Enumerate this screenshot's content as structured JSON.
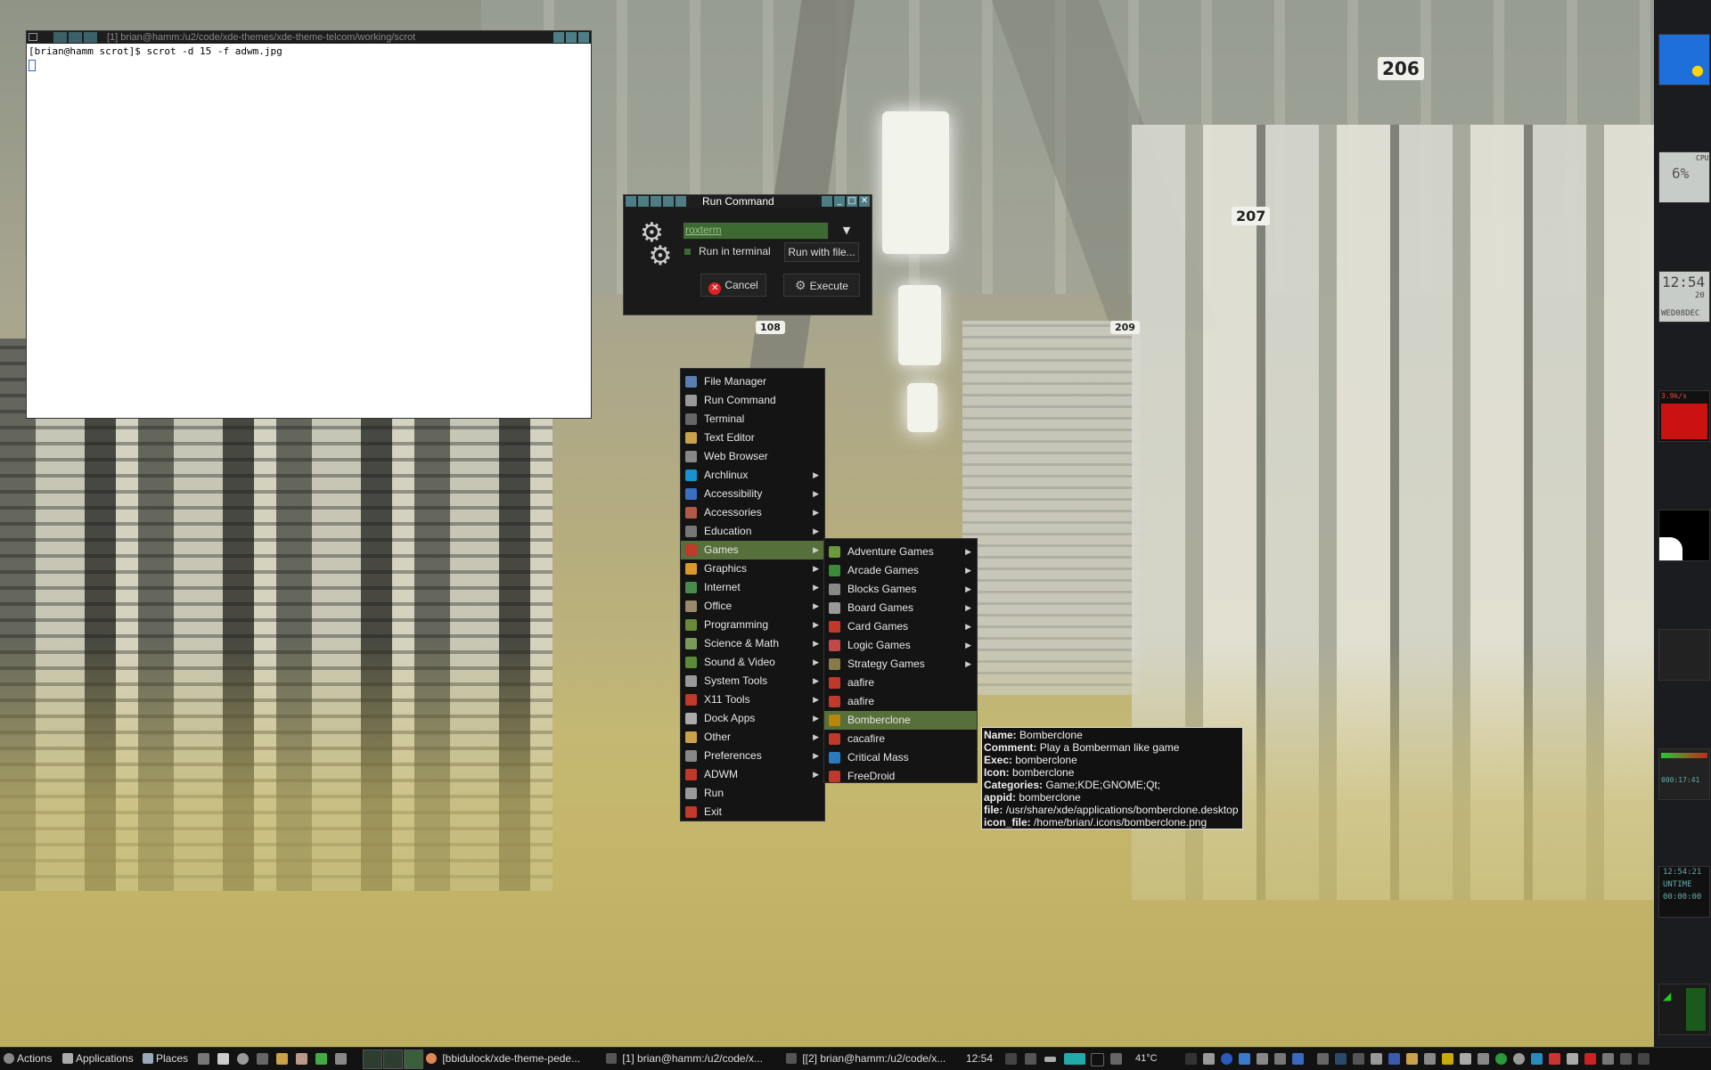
{
  "wallpaper": {
    "sign_206": "206",
    "sign_207": "207",
    "sign_108": "108",
    "sign_209": "209"
  },
  "terminal": {
    "title": "[1] brian@hamm:/u2/code/xde-themes/xde-theme-telcom/working/scrot",
    "prompt_line": "[brian@hamm scrot]$ scrot -d 15 -f adwm.jpg"
  },
  "run_command": {
    "title": "Run Command",
    "command_value": "roxterm",
    "run_in_terminal_label": "Run in terminal",
    "run_with_file_label": "Run with file...",
    "cancel_label": "Cancel",
    "execute_label": "Execute"
  },
  "main_menu": {
    "items": [
      {
        "label": "File Manager",
        "submenu": false,
        "icon": "folder-icon",
        "color": "#5a7fb0"
      },
      {
        "label": "Run Command",
        "submenu": false,
        "icon": "gears-icon",
        "color": "#9a9a9a"
      },
      {
        "label": "Terminal",
        "submenu": false,
        "icon": "terminal-icon",
        "color": "#666"
      },
      {
        "label": "Text Editor",
        "submenu": false,
        "icon": "text-editor-icon",
        "color": "#c9a24a"
      },
      {
        "label": "Web Browser",
        "submenu": false,
        "icon": "globe-icon",
        "color": "#888"
      },
      {
        "label": "Archlinux",
        "submenu": true,
        "icon": "arch-icon",
        "color": "#1793d1"
      },
      {
        "label": "Accessibility",
        "submenu": true,
        "icon": "accessibility-icon",
        "color": "#3b6fc2"
      },
      {
        "label": "Accessories",
        "submenu": true,
        "icon": "accessories-icon",
        "color": "#b05a4a"
      },
      {
        "label": "Education",
        "submenu": true,
        "icon": "education-icon",
        "color": "#777"
      },
      {
        "label": "Games",
        "submenu": true,
        "icon": "games-icon",
        "color": "#c0392b"
      },
      {
        "label": "Graphics",
        "submenu": true,
        "icon": "graphics-icon",
        "color": "#d99a2b"
      },
      {
        "label": "Internet",
        "submenu": true,
        "icon": "internet-icon",
        "color": "#4a8a4a"
      },
      {
        "label": "Office",
        "submenu": true,
        "icon": "office-icon",
        "color": "#9a8a6a"
      },
      {
        "label": "Programming",
        "submenu": true,
        "icon": "programming-icon",
        "color": "#6a8a3a"
      },
      {
        "label": "Science & Math",
        "submenu": true,
        "icon": "science-icon",
        "color": "#7a9a5a"
      },
      {
        "label": "Sound & Video",
        "submenu": true,
        "icon": "multimedia-icon",
        "color": "#5a8a3a"
      },
      {
        "label": "System Tools",
        "submenu": true,
        "icon": "system-tools-icon",
        "color": "#999"
      },
      {
        "label": "X11 Tools",
        "submenu": true,
        "icon": "x11-icon",
        "color": "#c0392b"
      },
      {
        "label": "Dock Apps",
        "submenu": true,
        "icon": "dock-apps-icon",
        "color": "#aaa"
      },
      {
        "label": "Other",
        "submenu": true,
        "icon": "other-icon",
        "color": "#c9a24a"
      },
      {
        "label": "Preferences",
        "submenu": true,
        "icon": "preferences-icon",
        "color": "#888"
      },
      {
        "label": "ADWM",
        "submenu": true,
        "icon": "adwm-icon",
        "color": "#c0392b"
      },
      {
        "label": "Run",
        "submenu": false,
        "icon": "run-icon",
        "color": "#9a9a9a"
      },
      {
        "label": "Exit",
        "submenu": false,
        "icon": "exit-icon",
        "color": "#c0392b"
      }
    ]
  },
  "games_menu": {
    "items": [
      {
        "label": "Adventure Games",
        "submenu": true,
        "icon": "adventure-icon",
        "color": "#6a9a3a"
      },
      {
        "label": "Arcade Games",
        "submenu": true,
        "icon": "arcade-icon",
        "color": "#3a8a3a"
      },
      {
        "label": "Blocks Games",
        "submenu": true,
        "icon": "blocks-icon",
        "color": "#888"
      },
      {
        "label": "Board Games",
        "submenu": true,
        "icon": "board-icon",
        "color": "#999"
      },
      {
        "label": "Card Games",
        "submenu": true,
        "icon": "cards-icon",
        "color": "#c0392b"
      },
      {
        "label": "Logic Games",
        "submenu": true,
        "icon": "logic-icon",
        "color": "#c04a4a"
      },
      {
        "label": "Strategy Games",
        "submenu": true,
        "icon": "strategy-icon",
        "color": "#8a7a4a"
      },
      {
        "label": "aafire",
        "submenu": false,
        "icon": "dice-icon",
        "color": "#c0392b"
      },
      {
        "label": "aafire",
        "submenu": false,
        "icon": "dice-icon",
        "color": "#c0392b"
      },
      {
        "label": "Bomberclone",
        "submenu": false,
        "icon": "bomberclone-icon",
        "color": "#b8860b"
      },
      {
        "label": "cacafire",
        "submenu": false,
        "icon": "dice-icon",
        "color": "#c0392b"
      },
      {
        "label": "Critical Mass",
        "submenu": false,
        "icon": "critical-mass-icon",
        "color": "#2a7ac0"
      },
      {
        "label": "FreeDroid",
        "submenu": false,
        "icon": "freedroid-icon",
        "color": "#c0392b"
      }
    ]
  },
  "tooltip": {
    "name_label": "Name:",
    "name": "Bomberclone",
    "comment_label": "Comment:",
    "comment": "Play a Bomberman like game",
    "exec_label": "Exec:",
    "exec": "bomberclone",
    "icon_label": "Icon:",
    "icon": "bomberclone",
    "categories_label": "Categories:",
    "categories": "Game;KDE;GNOME;Qt;",
    "appid_label": "appid:",
    "appid": "bomberclone",
    "file_label": "file:",
    "file": "/usr/share/xde/applications/bomberclone.desktop",
    "icon_file_label": "icon_file:",
    "icon_file": "/home/brian/.icons/bomberclone.png"
  },
  "dock": {
    "cpu_label": "CPU",
    "cpu_value": "6%",
    "clock_time": "12:54",
    "clock_seconds": "20",
    "clock_date": "WED08DEC",
    "net_rate": "3.9k/s",
    "mini_time": "000:17:41",
    "uptime_clock": "12:54:21",
    "uptime_label": "UNTIME",
    "uptime_value": "00:00:00"
  },
  "taskbar": {
    "actions_label": "Actions",
    "applications_label": "Applications",
    "places_label": "Places",
    "task1": "[bbidulock/xde-theme-pede...",
    "task2": "[1] brian@hamm:/u2/code/x...",
    "task3": "[[2] brian@hamm:/u2/code/x...",
    "clock": "12:54",
    "temperature": "41°C"
  }
}
